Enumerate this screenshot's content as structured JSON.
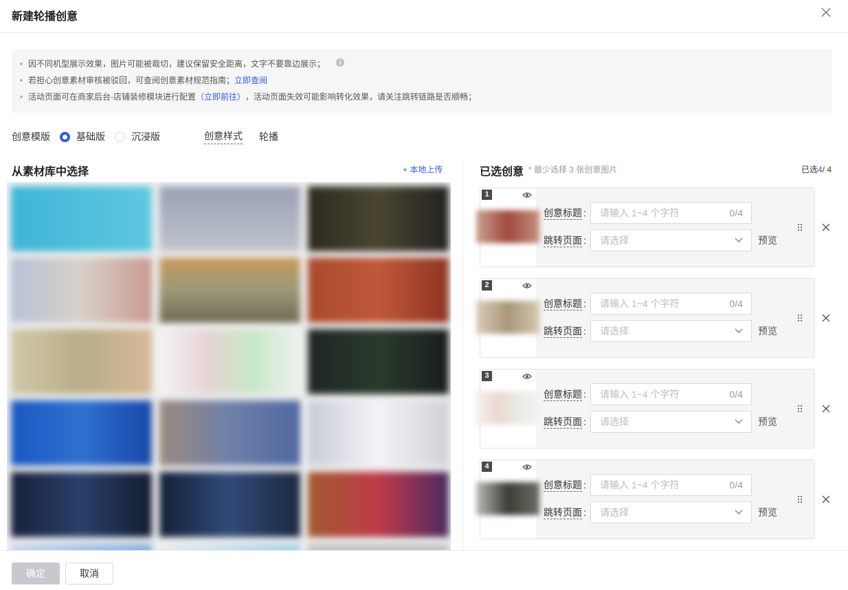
{
  "dialog": {
    "title": "新建轮播创意"
  },
  "notice": {
    "line1": "因不同机型展示效果，图片可能被裁切，建议保留安全距离，文字不要靠边展示；",
    "line2_text": "若担心创意素材审核被驳回，可查阅创意素材规范指南；",
    "line2_link": "立即查阅",
    "line3_pre": "活动页面可在商家后台-店铺装修模块进行配置",
    "line3_link": "（立即前往）",
    "line3_post": "，活动页面失效可能影响转化效果，请关注跳转链路是否顺畅；"
  },
  "template": {
    "label": "创意模版",
    "options": [
      "基础版",
      "沉浸版"
    ],
    "selected": "基础版",
    "style_label": "创意样式",
    "style_value": "轮播"
  },
  "library": {
    "title": "从素材库中选择",
    "upload": "+ 本地上传"
  },
  "selected_panel": {
    "title": "已选创意",
    "subtitle": "* 最少选择 3 张创意图片",
    "count_prefix": "已选",
    "count_current": "4",
    "count_total": "/ 4"
  },
  "cards": [
    {
      "index": "1",
      "title_label": "创意标题",
      "colon": ":",
      "title_placeholder": "请输入 1~4 个字符",
      "title_count": "0/4",
      "jump_label": "跳转页面",
      "jump_placeholder": "请选择",
      "preview": "预览"
    },
    {
      "index": "2",
      "title_label": "创意标题",
      "colon": ":",
      "title_placeholder": "请输入 1~4 个字符",
      "title_count": "0/4",
      "jump_label": "跳转页面",
      "jump_placeholder": "请选择",
      "preview": "预览"
    },
    {
      "index": "3",
      "title_label": "创意标题",
      "colon": ":",
      "title_placeholder": "请输入 1~4 个字符",
      "title_count": "0/4",
      "jump_label": "跳转页面",
      "jump_placeholder": "请选择",
      "preview": "预览"
    },
    {
      "index": "4",
      "title_label": "创意标题",
      "colon": ":",
      "title_placeholder": "请输入 1~4 个字符",
      "title_count": "0/4",
      "jump_label": "跳转页面",
      "jump_placeholder": "请选择",
      "preview": "预览"
    }
  ],
  "footer": {
    "confirm": "确定",
    "cancel": "取消"
  },
  "colors": {
    "accent": "#2f5bea",
    "disabled_button": "#c7c9cf",
    "notice_bg": "#f6f6f6",
    "card_bg": "#f5f5f5"
  },
  "icons": [
    "close-icon",
    "info-icon",
    "eye-icon",
    "chevron-down-icon",
    "drag-handle-icon",
    "remove-icon"
  ]
}
